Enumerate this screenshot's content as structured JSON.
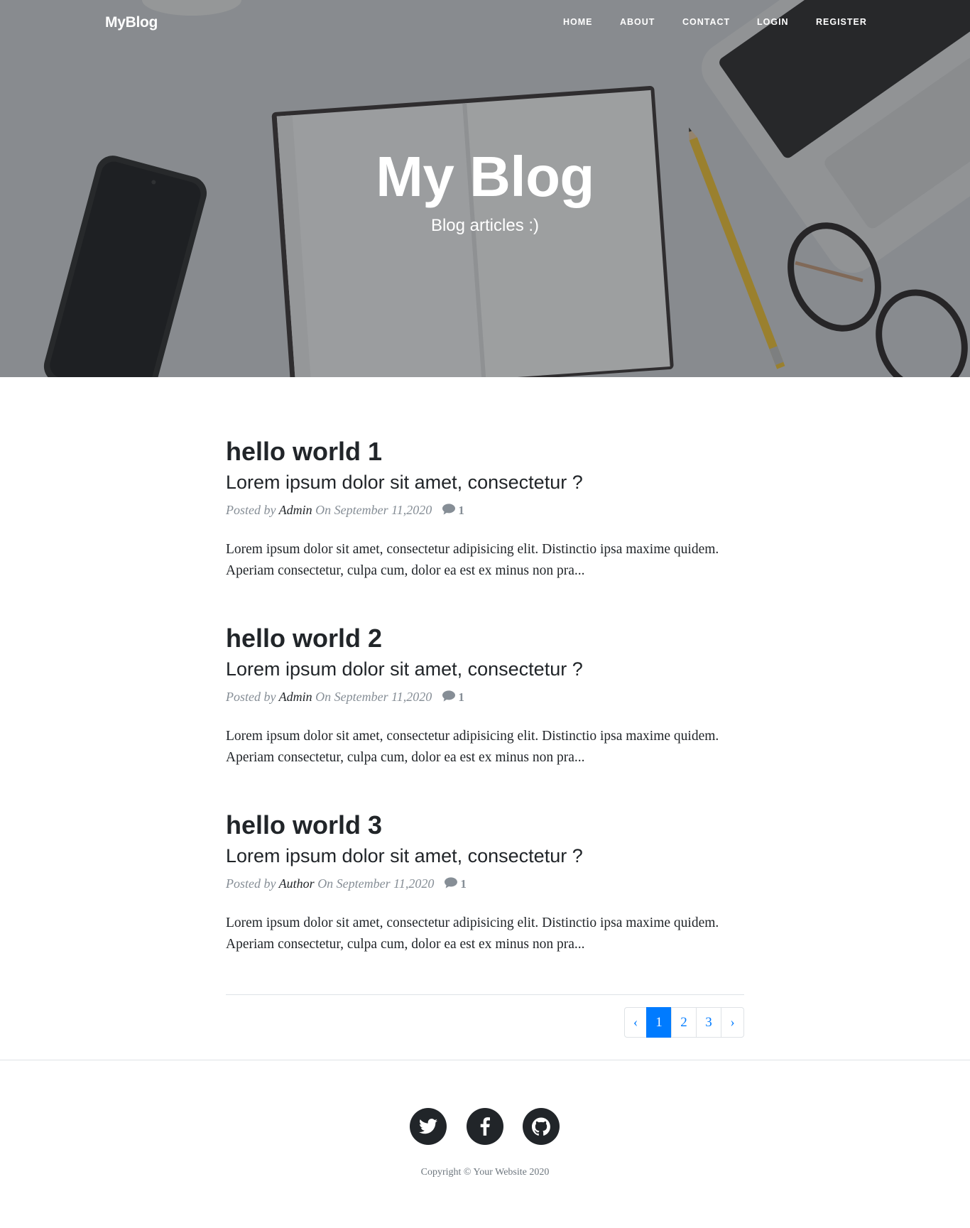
{
  "colors": {
    "accent": "#007bff",
    "text_dark": "#212529",
    "meta_gray": "#868e96",
    "footer_icon_bg": "#212529"
  },
  "navbar": {
    "brand": "MyBlog",
    "links": [
      "HOME",
      "ABOUT",
      "CONTACT",
      "LOGIN",
      "REGISTER"
    ]
  },
  "hero": {
    "heading": "My Blog",
    "subheading": "Blog articles :)"
  },
  "posts": [
    {
      "title": "hello world 1",
      "subtitle": "Lorem ipsum dolor sit amet, consectetur ?",
      "meta_prefix": "Posted by",
      "author": "Admin",
      "date": "On September 11,2020",
      "comments": "1",
      "excerpt": "Lorem ipsum dolor sit amet, consectetur adipisicing elit. Distinctio ipsa maxime quidem. Aperiam consectetur, culpa cum, dolor ea est ex minus non pra..."
    },
    {
      "title": "hello world 2",
      "subtitle": "Lorem ipsum dolor sit amet, consectetur ?",
      "meta_prefix": "Posted by",
      "author": "Admin",
      "date": "On September 11,2020",
      "comments": "1",
      "excerpt": "Lorem ipsum dolor sit amet, consectetur adipisicing elit. Distinctio ipsa maxime quidem. Aperiam consectetur, culpa cum, dolor ea est ex minus non pra..."
    },
    {
      "title": "hello world 3",
      "subtitle": "Lorem ipsum dolor sit amet, consectetur ?",
      "meta_prefix": "Posted by",
      "author": "Author",
      "date": "On September 11,2020",
      "comments": "1",
      "excerpt": "Lorem ipsum dolor sit amet, consectetur adipisicing elit. Distinctio ipsa maxime quidem. Aperiam consectetur, culpa cum, dolor ea est ex minus non pra..."
    }
  ],
  "comment_icon": "comment-icon",
  "pagination": {
    "prev": "‹",
    "pages": [
      "1",
      "2",
      "3"
    ],
    "active": "1",
    "next": "›"
  },
  "footer": {
    "social": [
      {
        "name": "twitter",
        "icon": "twitter-icon"
      },
      {
        "name": "facebook",
        "icon": "facebook-icon"
      },
      {
        "name": "github",
        "icon": "github-icon"
      }
    ],
    "copyright": "Copyright © Your Website 2020"
  }
}
